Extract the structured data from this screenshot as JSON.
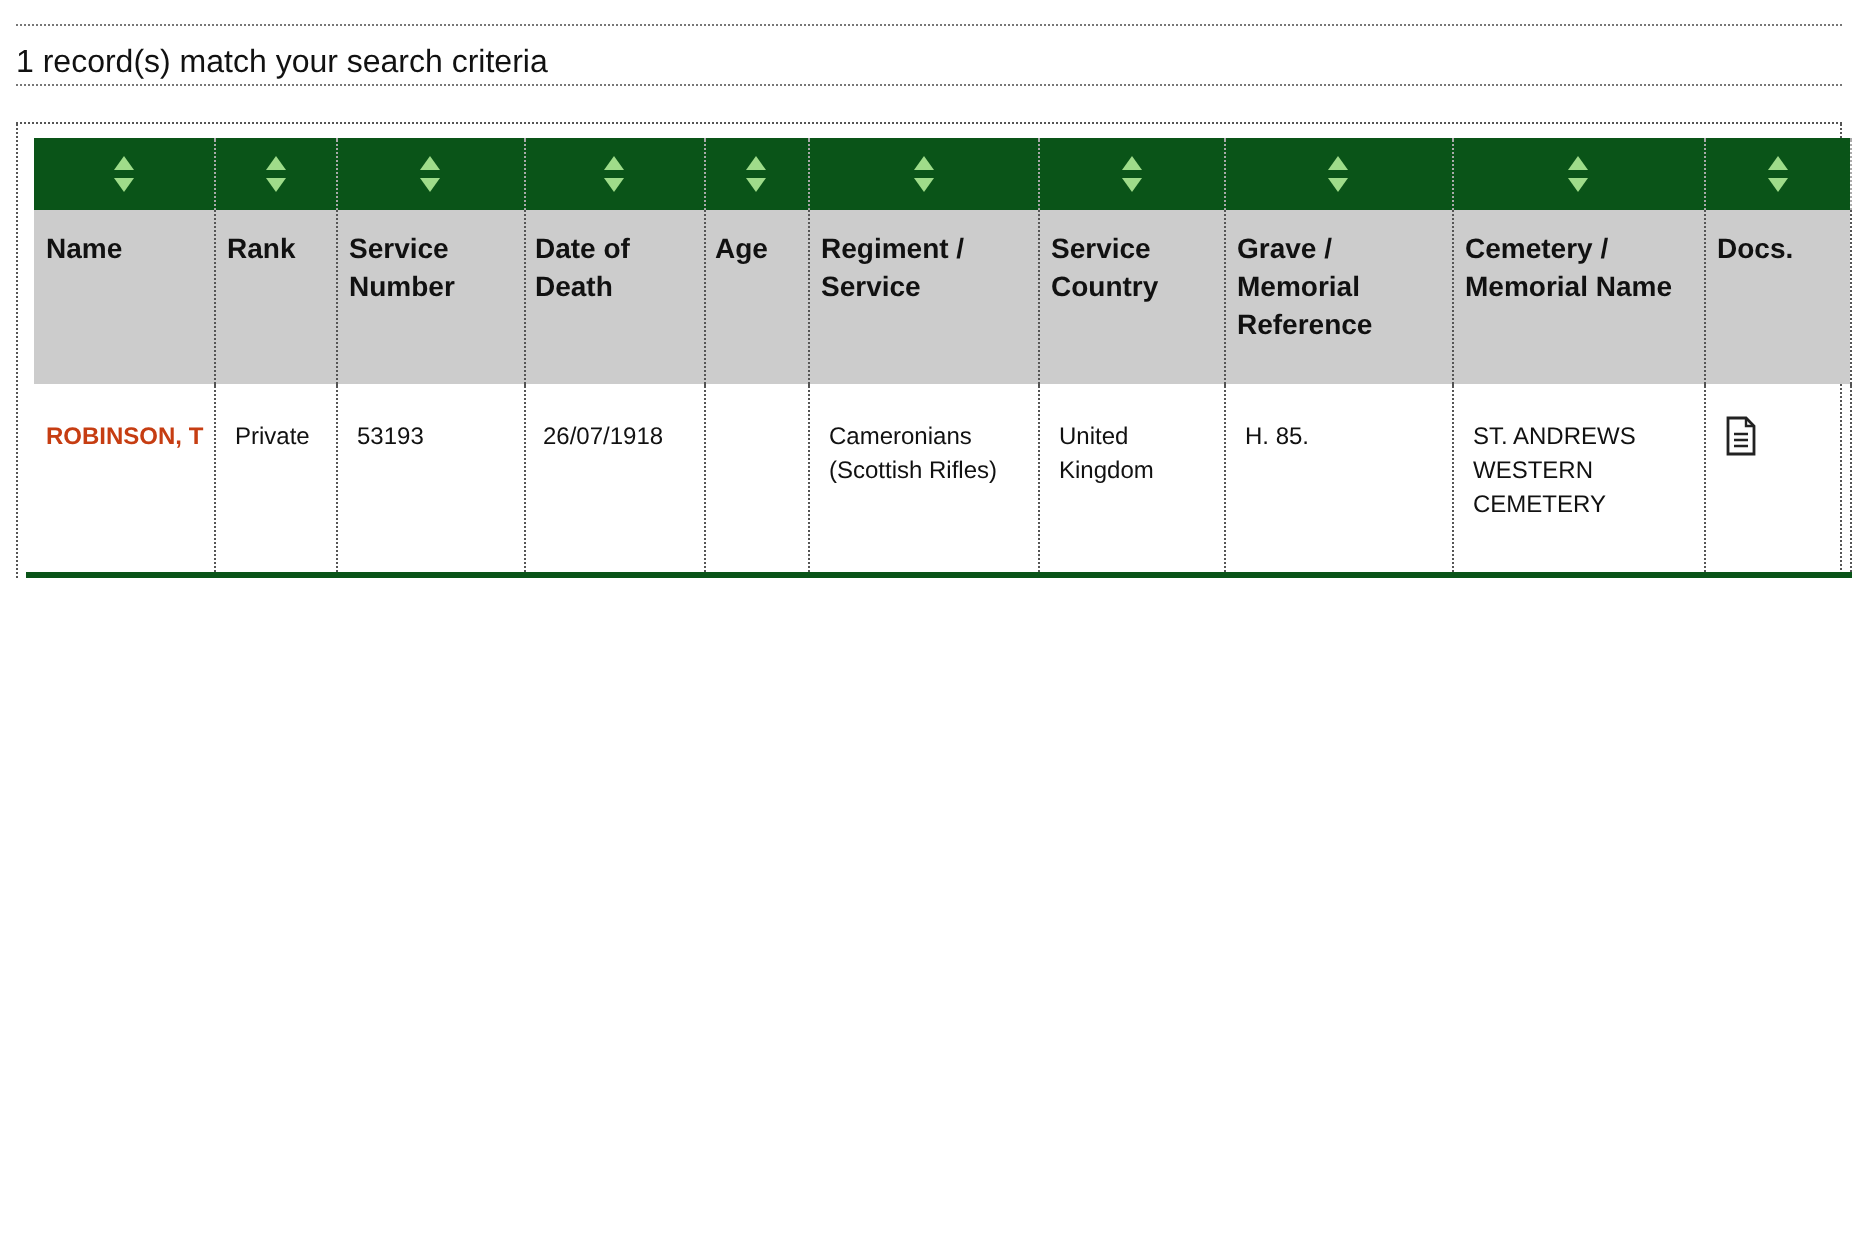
{
  "summary": "1 record(s) match your search criteria",
  "table": {
    "columns": [
      "Name",
      "Rank",
      "Service Number",
      "Date of Death",
      "Age",
      "Regiment / Service",
      "Service Country",
      "Grave / Memorial Reference",
      "Cemetery / Memorial Name",
      "Docs."
    ],
    "rows": [
      {
        "cells": [
          {
            "kind": "link",
            "text": "ROBINSON, T"
          },
          {
            "kind": "text",
            "text": "Private"
          },
          {
            "kind": "text",
            "text": "53193"
          },
          {
            "kind": "text",
            "text": "26/07/1918"
          },
          {
            "kind": "empty"
          },
          {
            "kind": "text",
            "text": "Cameronians (Scottish Rifles)"
          },
          {
            "kind": "text",
            "text": "United Kingdom"
          },
          {
            "kind": "text",
            "text": "H. 85."
          },
          {
            "kind": "text",
            "text": "ST. ANDREWS WESTERN CEMETERY"
          },
          {
            "kind": "document"
          }
        ]
      }
    ]
  }
}
